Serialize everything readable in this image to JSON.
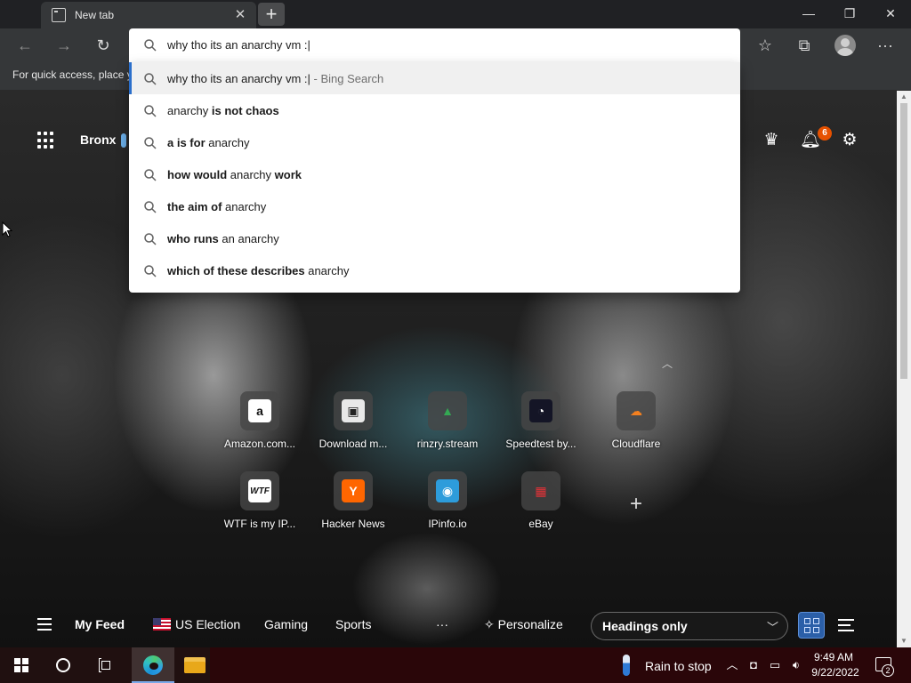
{
  "browser": {
    "tab_title": "New tab",
    "tab_close": "✕",
    "new_tab_symbol": "+",
    "window_controls": {
      "minimize": "—",
      "restore": "❐",
      "close": "✕"
    },
    "favorites_hint": "For quick access, place y"
  },
  "omnibox": {
    "value": "why tho its an anarchy vm :|"
  },
  "suggestions": [
    {
      "parts": [
        {
          "t": "why tho its an anarchy vm :|",
          "b": false
        }
      ],
      "suffix": " - Bing Search",
      "selected": true
    },
    {
      "parts": [
        {
          "t": "anarchy ",
          "b": false
        },
        {
          "t": "is not chaos",
          "b": true
        }
      ],
      "suffix": "",
      "selected": false
    },
    {
      "parts": [
        {
          "t": "a is for ",
          "b": true
        },
        {
          "t": "anarchy",
          "b": false
        }
      ],
      "suffix": "",
      "selected": false
    },
    {
      "parts": [
        {
          "t": "how would ",
          "b": true
        },
        {
          "t": "anarchy ",
          "b": false
        },
        {
          "t": "work",
          "b": true
        }
      ],
      "suffix": "",
      "selected": false
    },
    {
      "parts": [
        {
          "t": "the aim of ",
          "b": true
        },
        {
          "t": "anarchy",
          "b": false
        }
      ],
      "suffix": "",
      "selected": false
    },
    {
      "parts": [
        {
          "t": "who runs ",
          "b": true
        },
        {
          "t": "an anarchy",
          "b": false
        }
      ],
      "suffix": "",
      "selected": false
    },
    {
      "parts": [
        {
          "t": "which of these describes ",
          "b": true
        },
        {
          "t": "anarchy",
          "b": false
        }
      ],
      "suffix": "",
      "selected": false
    }
  ],
  "newtab": {
    "location": "Bronx",
    "notification_count": "6",
    "quick_links": [
      {
        "label": "Amazon.com...",
        "icon": "amazon-icon",
        "glyph": "a",
        "bg": "#ffffff",
        "fg": "#111111"
      },
      {
        "label": "Download m...",
        "icon": "download-icon",
        "glyph": "▣",
        "bg": "#e8e8e8",
        "fg": "#222222"
      },
      {
        "label": "rinzry.stream",
        "icon": "google-drive-icon",
        "glyph": "▲",
        "bg": "transparent",
        "fg": "#34a853"
      },
      {
        "label": "Speedtest by...",
        "icon": "speedtest-icon",
        "glyph": "◔",
        "bg": "#141526",
        "fg": "#ffffff"
      },
      {
        "label": "Cloudflare",
        "icon": "cloudflare-icon",
        "glyph": "☁",
        "bg": "transparent",
        "fg": "#f38020"
      },
      {
        "label": "WTF is my IP...",
        "icon": "wtf-icon",
        "glyph": "WTF",
        "bg": "#ffffff",
        "fg": "#111111"
      },
      {
        "label": "Hacker News",
        "icon": "hacker-news-icon",
        "glyph": "Y",
        "bg": "#ff6600",
        "fg": "#ffffff"
      },
      {
        "label": "IPinfo.io",
        "icon": "ipinfo-icon",
        "glyph": "◉",
        "bg": "#2d9cdb",
        "fg": "#ffffff"
      },
      {
        "label": "eBay",
        "icon": "ebay-icon",
        "glyph": "▦",
        "bg": "transparent",
        "fg": "#e53238"
      }
    ],
    "feed": {
      "my_feed": "My Feed",
      "us_election": "US Election",
      "gaming": "Gaming",
      "sports": "Sports",
      "more": "···",
      "personalize": "Personalize",
      "headings_option": "Headings only"
    }
  },
  "taskbar": {
    "weather_text": "Rain to stop",
    "time": "9:49 AM",
    "date": "9/22/2022",
    "notification_count": "2"
  }
}
